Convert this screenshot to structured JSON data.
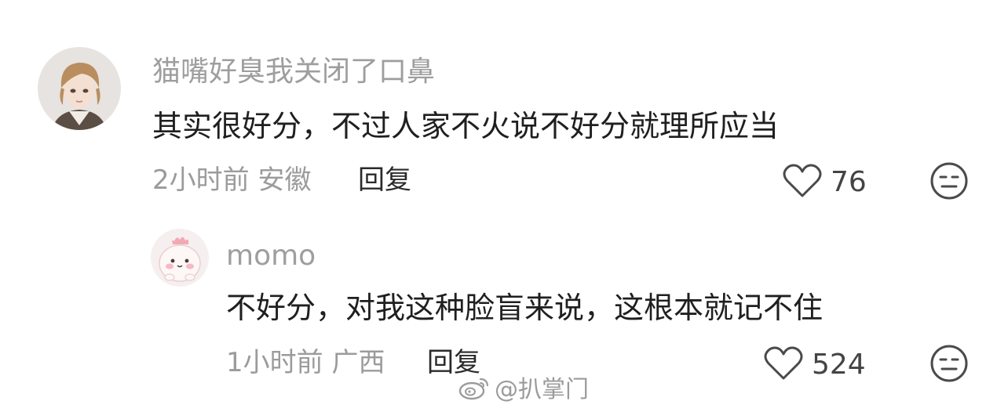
{
  "comments": [
    {
      "username": "猫嘴好臭我关闭了口鼻",
      "content": "其实很好分，不过人家不火说不好分就理所应当",
      "time_location": "2小时前 安徽",
      "reply_label": "回复",
      "likes": "76",
      "avatar_icon": "user-avatar-doll",
      "like_icon": "heart-outline-icon",
      "dislike_icon": "meh-face-icon"
    },
    {
      "username": "momo",
      "content": "不好分，对我这种脸盲来说，这根本就记不住",
      "time_location": "1小时前 广西",
      "reply_label": "回复",
      "likes": "524",
      "avatar_icon": "user-avatar-cartoon",
      "like_icon": "heart-outline-icon",
      "dislike_icon": "meh-face-icon"
    }
  ],
  "watermark": {
    "text": "@扒掌门",
    "icon": "weibo-logo-icon"
  },
  "colors": {
    "username": "#9e9e9e",
    "content": "#1f1f1f",
    "meta": "#9b9b9b",
    "icon_stroke": "#4a4a4a"
  }
}
